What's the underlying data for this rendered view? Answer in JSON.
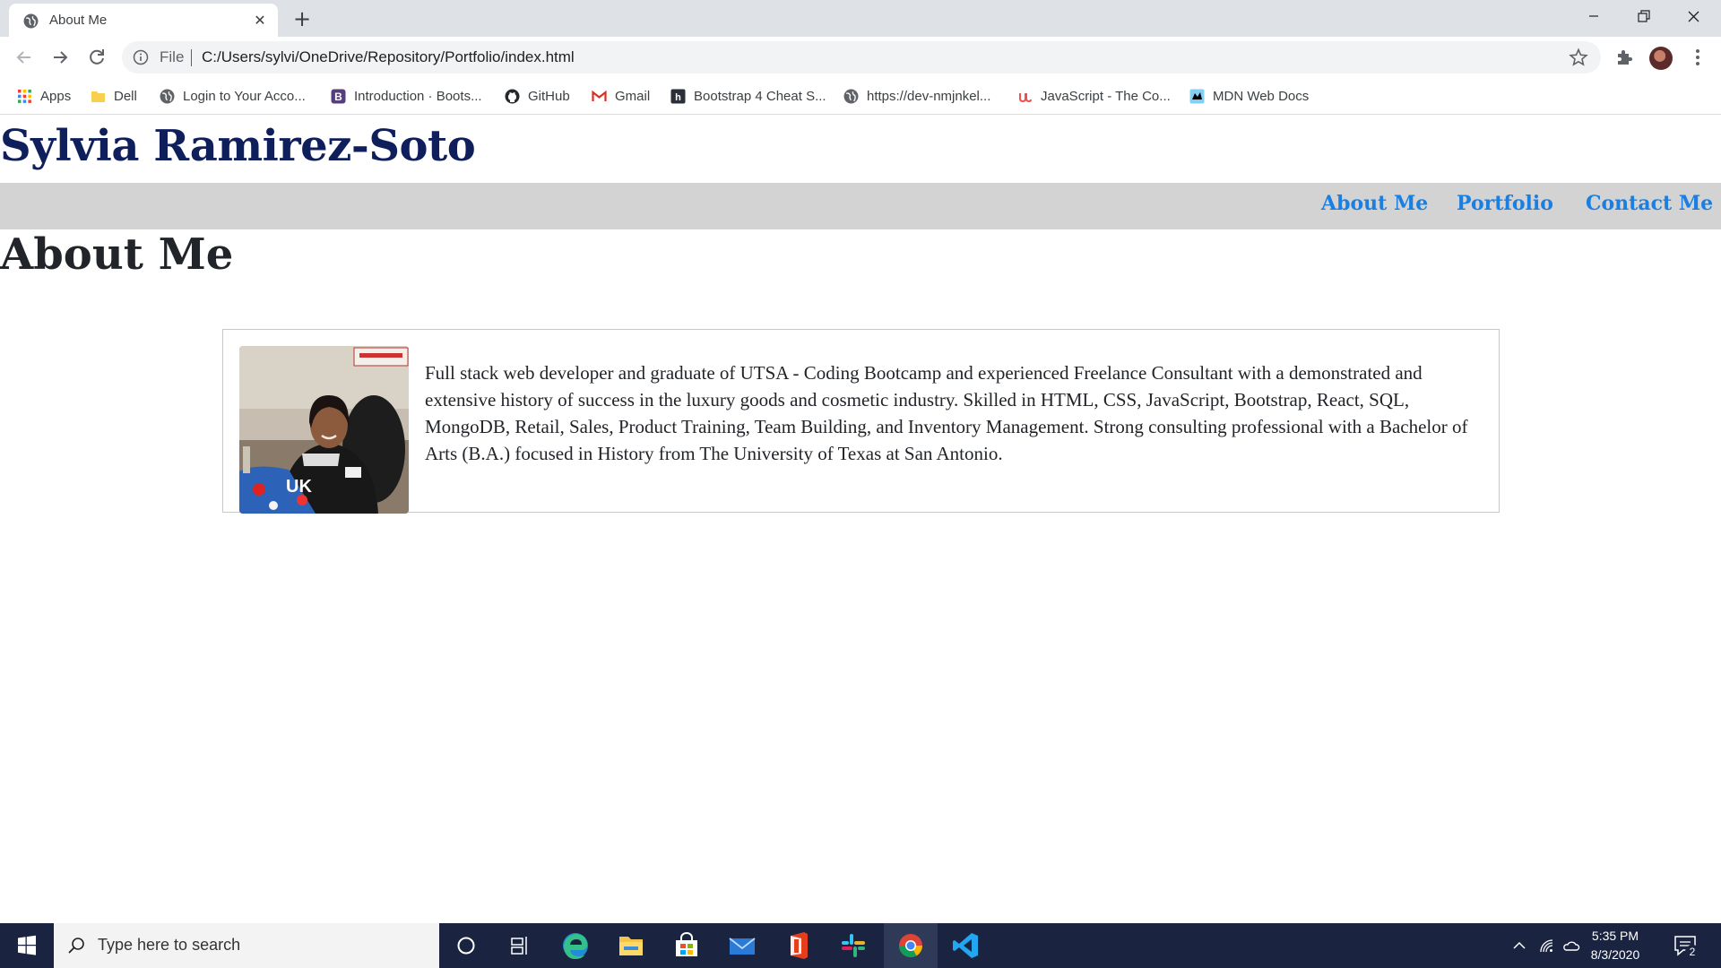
{
  "browser": {
    "tab": {
      "title": "About Me",
      "close_glyph": "✕"
    },
    "new_tab_glyph": "+",
    "address": {
      "scheme": "File",
      "url": "C:/Users/sylvi/OneDrive/Repository/Portfolio/index.html"
    },
    "bookmarks": [
      {
        "label": "Apps",
        "icon": "apps-grid-icon"
      },
      {
        "label": "Dell",
        "icon": "folder-icon"
      },
      {
        "label": "Login to Your Acco...",
        "icon": "globe-icon"
      },
      {
        "label": "Introduction · Boots...",
        "icon": "bootstrap-icon"
      },
      {
        "label": "GitHub",
        "icon": "github-icon"
      },
      {
        "label": "Gmail",
        "icon": "gmail-icon"
      },
      {
        "label": "Bootstrap 4 Cheat S...",
        "icon": "hackerthemes-icon"
      },
      {
        "label": "https://dev-nmjnkel...",
        "icon": "globe-icon"
      },
      {
        "label": "JavaScript - The Co...",
        "icon": "udemy-icon"
      },
      {
        "label": "MDN Web Docs",
        "icon": "mdn-icon"
      }
    ]
  },
  "page": {
    "site_title": "Sylvia Ramirez-Soto",
    "nav": [
      "About Me",
      "Portfolio",
      "Contact Me"
    ],
    "heading": "About Me",
    "bio": "Full stack web developer and graduate of UTSA - Coding Bootcamp and experienced Freelance Consultant with a demonstrated and extensive history of success in the luxury goods and cosmetic industry. Skilled in HTML, CSS, JavaScript, Bootstrap, React, SQL, MongoDB, Retail, Sales, Product Training, Team Building, and Inventory Management. Strong consulting professional with a Bachelor of Arts (B.A.) focused in History from The University of Texas at San Antonio."
  },
  "taskbar": {
    "search_placeholder": "Type here to search",
    "time": "5:35 PM",
    "date": "8/3/2020",
    "notification_count": "2",
    "apps": [
      "cortana-icon",
      "task-view-icon",
      "edge-icon",
      "file-explorer-icon",
      "store-icon",
      "mail-icon",
      "office-icon",
      "slack-icon",
      "chrome-icon",
      "vscode-icon"
    ]
  },
  "colors": {
    "site_title": "#0f1f5c",
    "nav_link": "#1a7fe0",
    "navbar_bg": "#d3d3d3",
    "taskbar_bg": "#1a2440"
  }
}
